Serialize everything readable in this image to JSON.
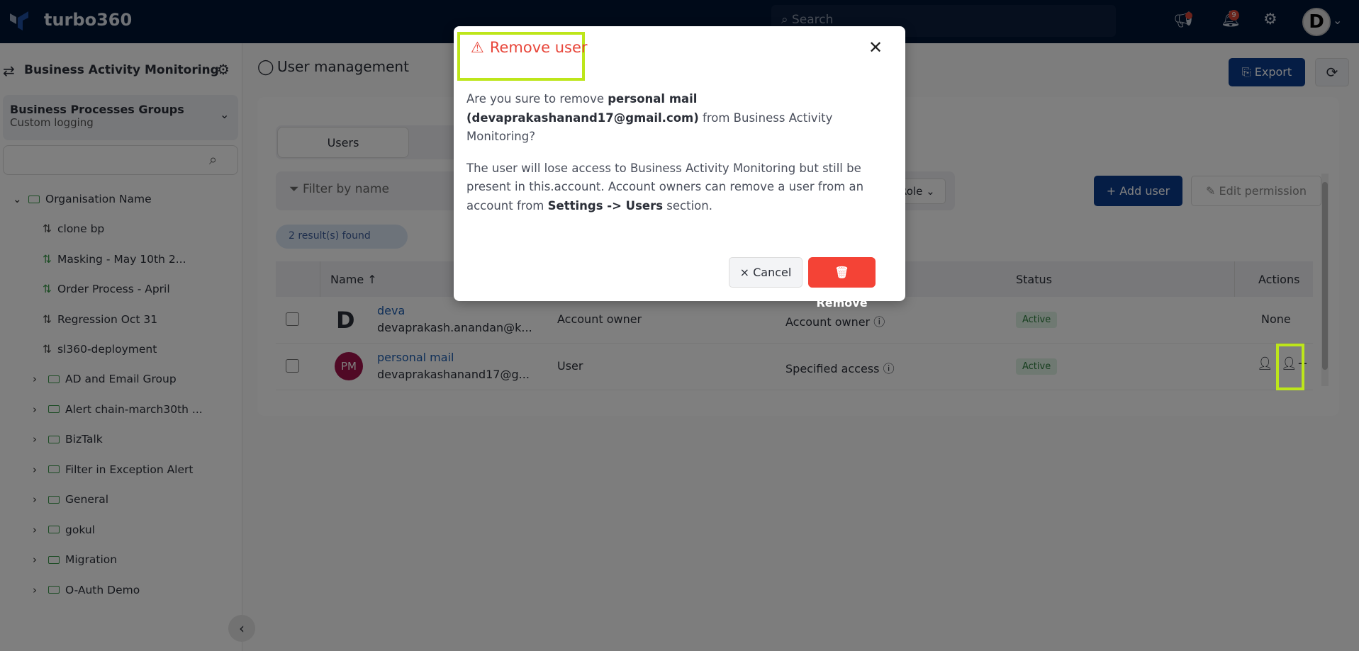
{
  "header": {
    "brand": "turbo360",
    "search_placeholder": "Search",
    "notification_count": "9",
    "avatar_letter": "D"
  },
  "sidebar": {
    "title": "Business Activity Monitoring",
    "group": {
      "title": "Business Processes Groups",
      "subtitle": "Custom logging"
    },
    "root": "Organisation Name",
    "processes": [
      "clone bp",
      "Masking - May 10th 2...",
      "Order Process - April",
      "Regression Oct 31",
      "sl360-deployment"
    ],
    "folders": [
      "AD and Email Group",
      "Alert chain-march30th ...",
      "BizTalk",
      "Filter in Exception Alert",
      "General",
      "gokul",
      "Migration",
      "O-Auth Demo"
    ]
  },
  "page": {
    "title": "User management",
    "export": "Export",
    "tab_users": "Users",
    "filter_placeholder": "Filter by name",
    "role_filter": "Role",
    "add_user": "+ Add user",
    "edit_permission": "Edit permission",
    "results": "2 result(s) found"
  },
  "table": {
    "headers": {
      "name": "Name",
      "status": "Status",
      "actions": "Actions"
    },
    "rows": [
      {
        "avatar": "D",
        "name": "deva",
        "email": "devaprakash.anandan@k...",
        "role": "Account owner",
        "access": "Account owner",
        "status": "Active",
        "actions": "None"
      },
      {
        "avatar": "PM",
        "name": "personal mail",
        "email": "devaprakashanand17@g...",
        "role": "User",
        "access": "Specified access",
        "status": "Active",
        "actions": ""
      }
    ]
  },
  "modal": {
    "title": "Remove user",
    "q_pre": "Are you sure to remove ",
    "q_name": "personal mail (devaprakashanand17@gmail.com)",
    "q_post": " from Business Activity Monitoring?",
    "p_pre": "The user will lose access to Business Activity Monitoring but still be present in this.account. Account owners can remove a user from an account from ",
    "p_bold": "Settings -> Users",
    "p_post": " section.",
    "cancel": "× Cancel",
    "remove": "Remove"
  },
  "colors": {
    "header": "#001433",
    "primary": "#0b3a8a",
    "danger": "#f44336",
    "highlight": "#bde61a"
  }
}
